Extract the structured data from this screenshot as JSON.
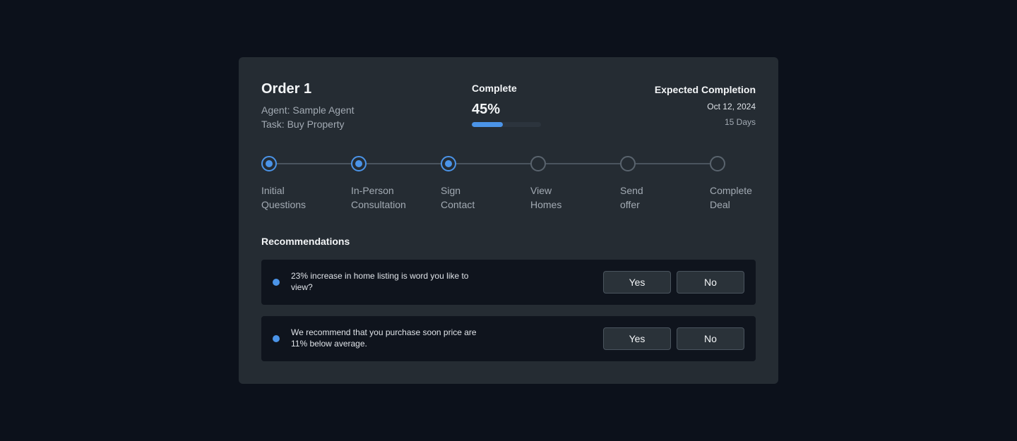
{
  "order": {
    "title": "Order 1",
    "agent": "Agent: Sample Agent",
    "task": "Task: Buy Property"
  },
  "progress": {
    "label": "Complete",
    "percent_text": "45%",
    "percent": 45,
    "accent_color": "#4b94e8"
  },
  "expected": {
    "label": "Expected Completion",
    "date": "Oct 12, 2024",
    "days": "15 Days"
  },
  "steps": [
    {
      "label": "Initial\nQuestions",
      "status": "done"
    },
    {
      "label": "In-Person\nConsultation",
      "status": "done"
    },
    {
      "label": "Sign\nContact",
      "status": "done"
    },
    {
      "label": "View\nHomes",
      "status": "todo"
    },
    {
      "label": "Send\noffer",
      "status": "todo"
    },
    {
      "label": "Complete\nDeal",
      "status": "todo"
    }
  ],
  "recommendations": {
    "heading": "Recommendations",
    "items": [
      {
        "text": "23% increase in home listing is word you like to view?",
        "yes_label": "Yes",
        "no_label": "No"
      },
      {
        "text": "We recommend that you purchase soon price are 11% below average.",
        "yes_label": "Yes",
        "no_label": "No"
      }
    ]
  }
}
